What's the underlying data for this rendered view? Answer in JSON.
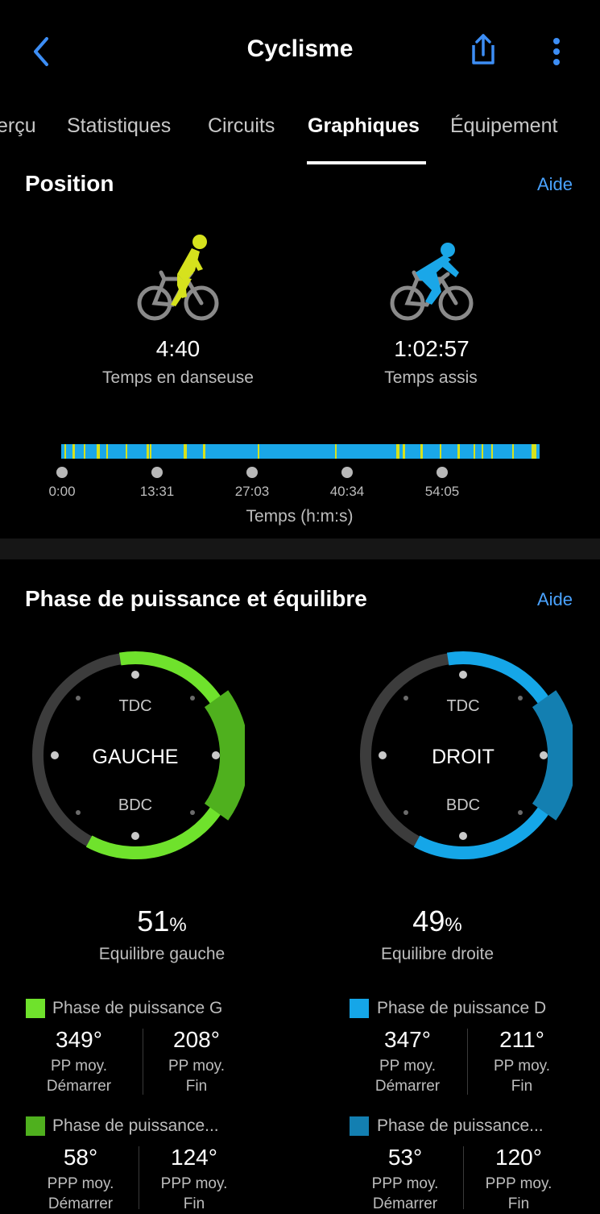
{
  "header": {
    "title": "Cyclisme"
  },
  "tabs": [
    {
      "label": "erçu"
    },
    {
      "label": "Statistiques"
    },
    {
      "label": "Circuits"
    },
    {
      "label": "Graphiques"
    },
    {
      "label": "Équipement"
    }
  ],
  "position": {
    "title": "Position",
    "help": "Aide",
    "standing": {
      "time": "4:40",
      "label": "Temps en danseuse",
      "color": "#d6e21d"
    },
    "seated": {
      "time": "1:02:57",
      "label": "Temps assis",
      "color": "#1aa7e8"
    },
    "timeline": {
      "ticks": [
        "0:00",
        "13:31",
        "27:03",
        "40:34",
        "54:05"
      ],
      "axis_label": "Temps (h:m:s)"
    }
  },
  "power": {
    "title": "Phase de puissance et équilibre",
    "help": "Aide",
    "left": {
      "label": "GAUCHE",
      "tdc": "TDC",
      "bdc": "BDC",
      "balance_value": "51",
      "balance_unit": "%",
      "balance_label": "Equilibre gauche",
      "color": "#6fe22c",
      "peak_color": "#4fb01e"
    },
    "right": {
      "label": "DROIT",
      "tdc": "TDC",
      "bdc": "BDC",
      "balance_value": "49",
      "balance_unit": "%",
      "balance_label": "Equilibre droite",
      "color": "#15a6e8",
      "peak_color": "#137fb1"
    },
    "legend": {
      "left_pp": {
        "name": "Phase de puissance G",
        "start_value": "349°",
        "start_line1": "PP moy.",
        "start_line2": "Démarrer",
        "end_value": "208°",
        "end_line1": "PP moy.",
        "end_line2": "Fin"
      },
      "right_pp": {
        "name": "Phase de puissance D",
        "start_value": "347°",
        "start_line1": "PP moy.",
        "start_line2": "Démarrer",
        "end_value": "211°",
        "end_line1": "PP moy.",
        "end_line2": "Fin"
      },
      "left_ppp": {
        "name": "Phase de puissance...",
        "start_value": "58°",
        "start_line1": "PPP moy.",
        "start_line2": "Démarrer",
        "end_value": "124°",
        "end_line1": "PPP moy.",
        "end_line2": "Fin"
      },
      "right_ppp": {
        "name": "Phase de puissance...",
        "start_value": "53°",
        "start_line1": "PPP moy.",
        "start_line2": "Démarrer",
        "end_value": "120°",
        "end_line1": "PPP moy.",
        "end_line2": "Fin"
      }
    }
  }
}
